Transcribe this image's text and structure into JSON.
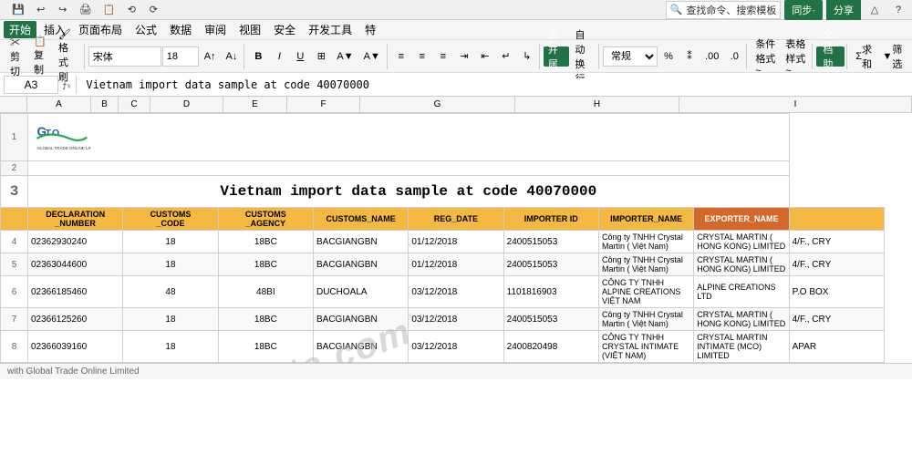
{
  "title": "Vietnam import data sample at code 40070000",
  "menu": {
    "items": [
      "开始",
      "插入",
      "页面布局",
      "公式",
      "数据",
      "审阅",
      "视图",
      "安全",
      "开发工具",
      "特"
    ]
  },
  "toolbar": {
    "font_name": "宋体",
    "font_size": "18",
    "clipboard": [
      "剪切",
      "复制",
      "格式刷"
    ],
    "bold": "B",
    "italic": "I",
    "underline": "U",
    "merge_center": "合并居中",
    "auto_wrap": "自动换行",
    "format_style": "常规",
    "conditional_format": "条件格式~",
    "table_style": "表格样式~",
    "document_assist": "文档助手",
    "sum": "求和",
    "filter": "筛选"
  },
  "formula_bar": {
    "cell_ref": "A3",
    "formula": "Vietnam import data sample at code 40070000"
  },
  "col_headers": [
    "A",
    "B",
    "C",
    "D",
    "E",
    "F",
    "G",
    "H",
    "I"
  ],
  "spreadsheet_title": "Vietnam import data sample at code 40070000",
  "table_headers": [
    "DECLARATION_NUMBER",
    "CUSTOMS_CODE",
    "CUSTOMS_AGENCY",
    "CUSTOMS_NAME",
    "REG_DATE",
    "IMPORTER_ID",
    "IMPORTER_NAME",
    "EXPORTER_NAME",
    ""
  ],
  "table_rows": [
    {
      "row_num": "4",
      "declaration_number": "02362930240",
      "customs_code": "18",
      "customs_agency": "18BC",
      "customs_name": "BACGIANGBN",
      "reg_date": "01/12/2018",
      "importer_id": "2400515053",
      "importer_name": "Công ty TNHH Crystal Martin ( Việt Nam)",
      "exporter_name": "CRYSTAL MARTIN ( HONG KONG) LIMITED",
      "extra": "4/F., CRY"
    },
    {
      "row_num": "5",
      "declaration_number": "02363044600",
      "customs_code": "18",
      "customs_agency": "18BC",
      "customs_name": "BACGIANGBN",
      "reg_date": "01/12/2018",
      "importer_id": "2400515053",
      "importer_name": "Công ty TNHH Crystal Martin ( Việt Nam)",
      "exporter_name": "CRYSTAL MARTIN ( HONG KONG) LIMITED",
      "extra": "4/F., CRY"
    },
    {
      "row_num": "6",
      "declaration_number": "02366185460",
      "customs_code": "48",
      "customs_agency": "48BI",
      "customs_name": "DUCHOALA",
      "reg_date": "03/12/2018",
      "importer_id": "1101816903",
      "importer_name": "CÔNG TY TNHH ALPINE CREATIONS VIỆT NAM",
      "exporter_name": "ALPINE CREATIONS  LTD",
      "extra": "P.O BOX"
    },
    {
      "row_num": "7",
      "declaration_number": "02366125260",
      "customs_code": "18",
      "customs_agency": "18BC",
      "customs_name": "BACGIANGBN",
      "reg_date": "03/12/2018",
      "importer_id": "2400515053",
      "importer_name": "Công ty TNHH Crystal Martin ( Việt Nam)",
      "exporter_name": "CRYSTAL MARTIN ( HONG KONG) LIMITED",
      "extra": "4/F., CRY"
    },
    {
      "row_num": "8",
      "declaration_number": "02366039160",
      "customs_code": "18",
      "customs_agency": "18BC",
      "customs_name": "BACGIANGBN",
      "reg_date": "03/12/2018",
      "importer_id": "2400820498",
      "importer_name": "CÔNG TY TNHH CRYSTAL INTIMATE (VIỆT NAM)",
      "exporter_name": "CRYSTAL MARTIN INTIMATE (MCO) LIMITED",
      "extra": "APAR"
    }
  ],
  "status_bar": {
    "text": "with Global Trade Online Limited"
  },
  "watermark": "gtadata.com",
  "search_placeholder": "查找命令、搜索模板",
  "right_actions": [
    "同步·",
    "分享",
    "△",
    "?"
  ]
}
